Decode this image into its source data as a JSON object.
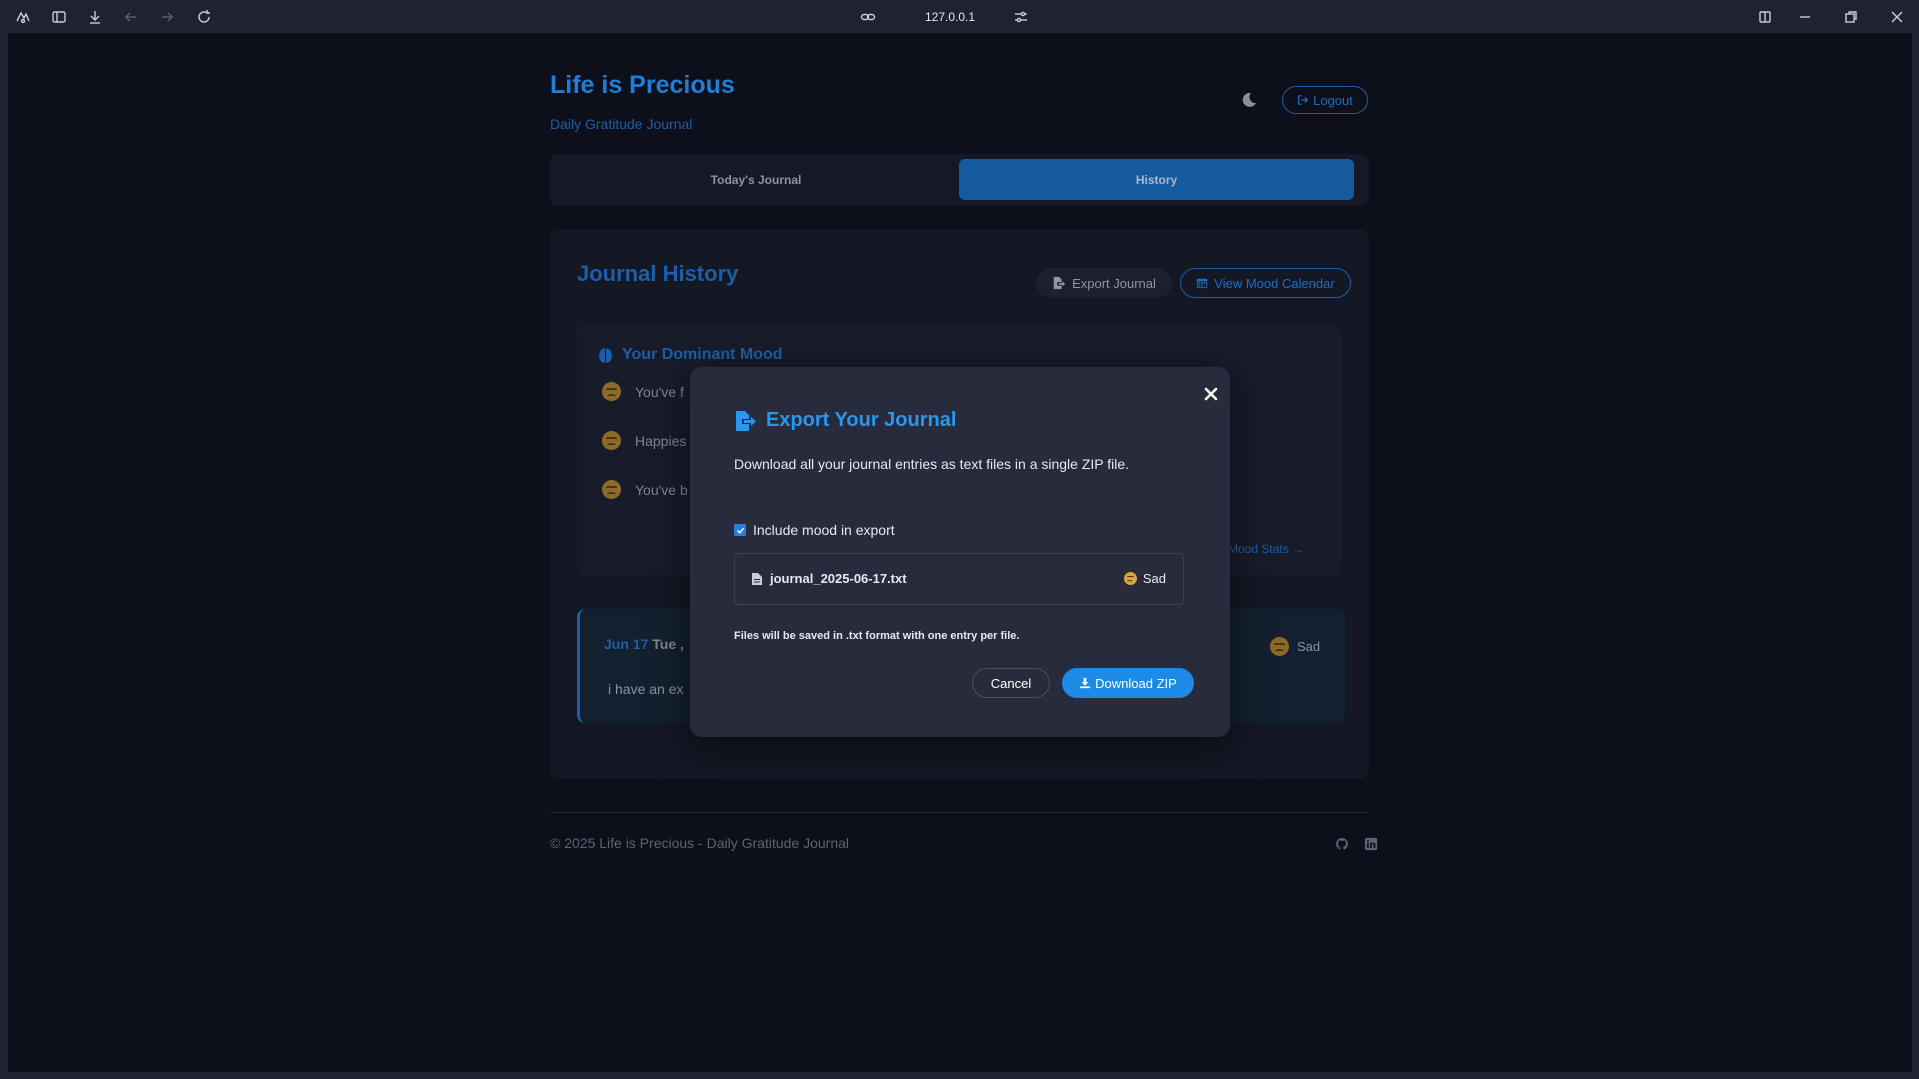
{
  "browser": {
    "url": "127.0.0.1"
  },
  "header": {
    "title": "Life is Precious",
    "subtitle": "Daily Gratitude Journal",
    "logout_label": "Logout"
  },
  "tabs": [
    {
      "label": "Today's Journal",
      "active": false
    },
    {
      "label": "History",
      "active": true
    }
  ],
  "history": {
    "title": "Journal History",
    "export_label": "Export Journal",
    "calendar_label": "View Mood Calendar",
    "dominant_mood": {
      "heading": "Your Dominant Mood",
      "lines": [
        "You've f",
        "Happies",
        "You've b"
      ],
      "stats_link": "Mood Stats"
    },
    "entry": {
      "date": "Jun 17",
      "dow": "Tue ,",
      "text": "i have an ex",
      "mood": "Sad"
    }
  },
  "footer": {
    "text": "© 2025 Life is Precious - Daily Gratitude Journal"
  },
  "modal": {
    "title": "Export Your Journal",
    "description": "Download all your journal entries as text files in a single ZIP file.",
    "include_mood_label": "Include mood in export",
    "include_mood_checked": true,
    "file_name": "journal_2025-06-17.txt",
    "file_mood": "Sad",
    "note": "Files will be saved in .txt format with one entry per file.",
    "cancel_label": "Cancel",
    "download_label": "Download ZIP"
  },
  "colors": {
    "accent": "#1e8ae8",
    "background": "#0d0f1a",
    "modal_bg": "#282b3c"
  }
}
